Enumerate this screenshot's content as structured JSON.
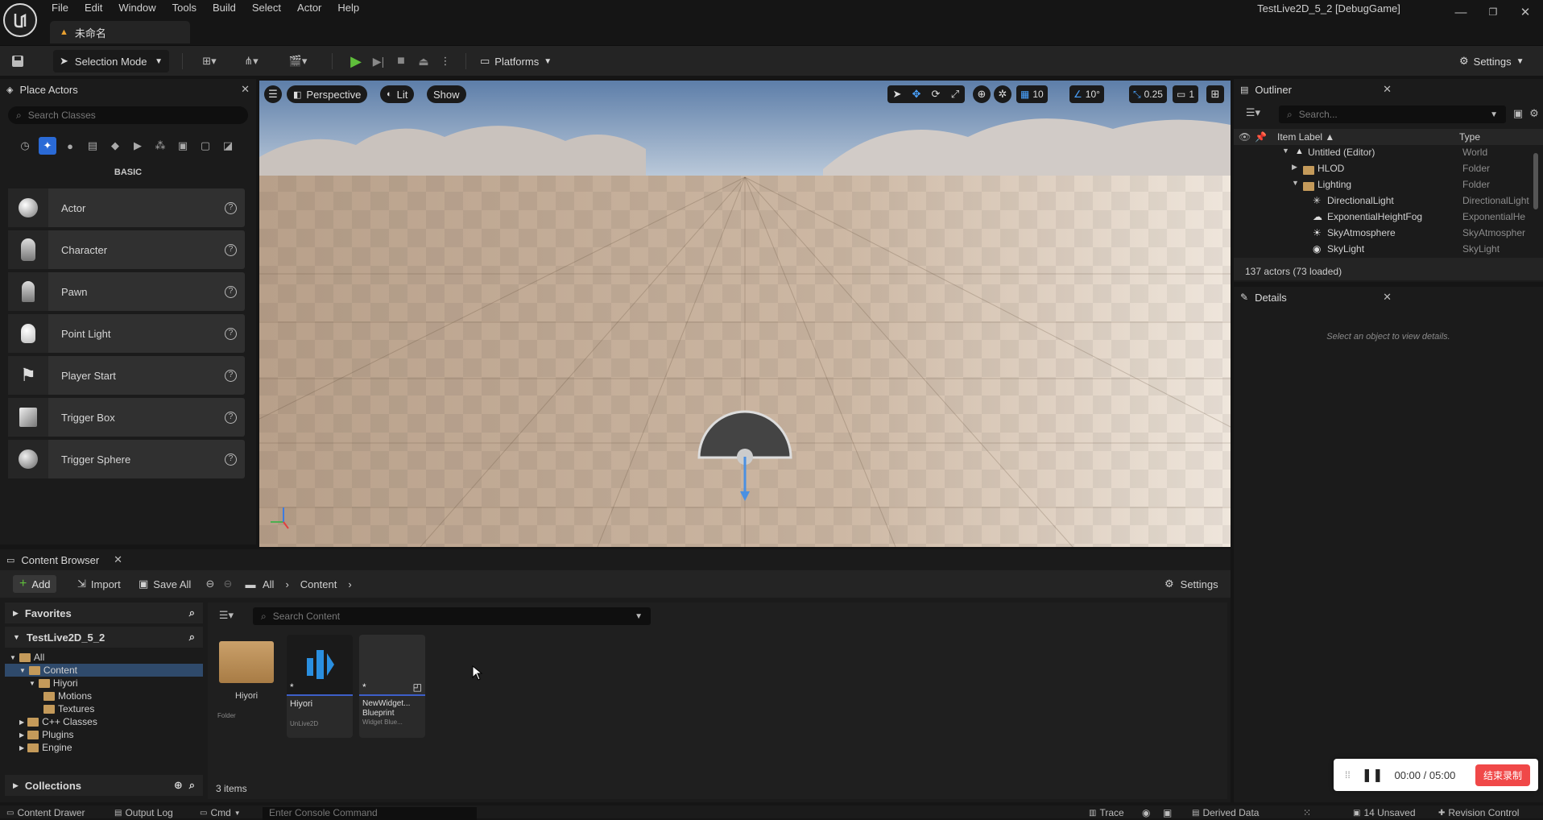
{
  "menu": [
    "File",
    "Edit",
    "Window",
    "Tools",
    "Build",
    "Select",
    "Actor",
    "Help"
  ],
  "doc_tab": "未命名",
  "project_title": "TestLive2D_5_2 [DebugGame]",
  "toolbar": {
    "selection_mode": "Selection Mode",
    "platforms": "Platforms",
    "settings": "Settings"
  },
  "place_actors": {
    "title": "Place Actors",
    "search_placeholder": "Search Classes",
    "category": "BASIC",
    "items": [
      "Actor",
      "Character",
      "Pawn",
      "Point Light",
      "Player Start",
      "Trigger Box",
      "Trigger Sphere"
    ]
  },
  "viewport": {
    "perspective": "Perspective",
    "lit": "Lit",
    "show": "Show",
    "grid_snap": "10",
    "rot_snap": "10°",
    "scale_snap": "0.25",
    "camera_speed": "1"
  },
  "outliner": {
    "title": "Outliner",
    "search_placeholder": "Search...",
    "col_label": "Item Label ▲",
    "col_type": "Type",
    "rows": [
      {
        "label": "Untitled (Editor)",
        "type": "World"
      },
      {
        "label": "HLOD",
        "type": "Folder"
      },
      {
        "label": "Lighting",
        "type": "Folder"
      },
      {
        "label": "DirectionalLight",
        "type": "DirectionalLight"
      },
      {
        "label": "ExponentialHeightFog",
        "type": "ExponentialHe"
      },
      {
        "label": "SkyAtmosphere",
        "type": "SkyAtmospher"
      },
      {
        "label": "SkyLight",
        "type": "SkyLight"
      }
    ],
    "footer": "137 actors (73 loaded)"
  },
  "details": {
    "title": "Details",
    "empty": "Select an object to view details."
  },
  "content_browser": {
    "title": "Content Browser",
    "add": "Add",
    "import": "Import",
    "save_all": "Save All",
    "settings": "Settings",
    "breadcrumb": [
      "All",
      "Content"
    ],
    "favorites": "Favorites",
    "project": "TestLive2D_5_2",
    "tree": [
      "All",
      "Content",
      "Hiyori",
      "Motions",
      "Textures",
      "C++ Classes",
      "Plugins",
      "Engine"
    ],
    "search_placeholder": "Search Content",
    "collections": "Collections",
    "items_count": "3 items",
    "assets": [
      {
        "name": "Hiyori",
        "type": "Folder"
      },
      {
        "name": "Hiyori",
        "type": "UnLive2D"
      },
      {
        "name": "NewWidget... Blueprint",
        "type": "Widget Blue..."
      }
    ]
  },
  "status_bar": {
    "content_drawer": "Content Drawer",
    "output_log": "Output Log",
    "cmd": "Cmd",
    "console_placeholder": "Enter Console Command",
    "trace": "Trace",
    "derived_data": "Derived Data",
    "unsaved": "14 Unsaved",
    "revision_control": "Revision Control"
  },
  "recording": {
    "time": "00:00 / 05:00",
    "stop": "结束录制"
  }
}
